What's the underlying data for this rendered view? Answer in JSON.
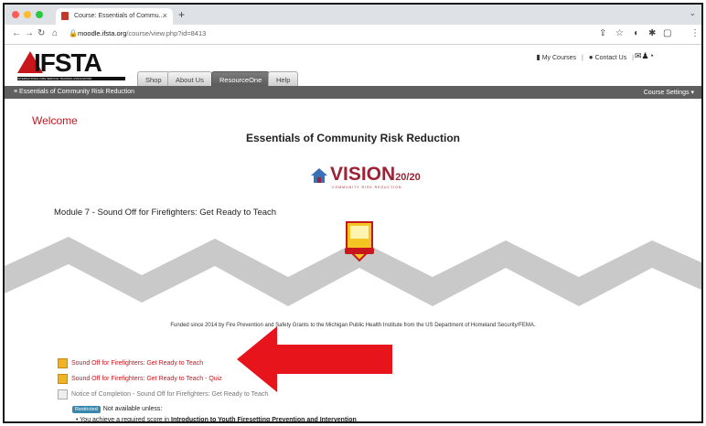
{
  "browser": {
    "tab_title": "Course: Essentials of Commu...",
    "new_tab": "+",
    "url_host": "moodle.ifsta.org",
    "url_path": "/course/view.php?id=8413"
  },
  "site": {
    "logo_text": "IFSTA",
    "logo_tagline": "INTERNATIONAL FIRE SERVICE TRAINING ASSOCIATION",
    "nav_tabs": [
      {
        "label": "Shop"
      },
      {
        "label": "About Us"
      },
      {
        "label": "ResourceOne"
      },
      {
        "label": "Help"
      }
    ],
    "my_courses": "My Courses",
    "contact_us": "Contact Us",
    "separator": "|",
    "breadcrumb": "Essentials of Community Risk Reduction",
    "course_settings": "Course Settings ▾"
  },
  "content": {
    "welcome": "Welcome",
    "course_title": "Essentials of Community Risk Reduction",
    "vision_text": "VISION",
    "vision_sub": "20/20",
    "vision_tag": "COMMUNITY RISK REDUCTION",
    "module_title": "Module 7 - Sound Off for Firefighters: Get Ready to Teach",
    "funded": "Funded since 2014 by Fire Prevention and Safety Grants to the Michigan Public Health Institute from the US Department of Homeland Security/FEMA.",
    "activities": [
      {
        "label": "Sound Off for Firefighters: Get Ready to Teach"
      },
      {
        "label": "Sound Off for Firefighters: Get Ready to Teach - Quiz"
      },
      {
        "label": "Notice of Completion - Sound Off for Firefighters: Get Ready to Teach"
      }
    ],
    "restricted_pill": "Restricted",
    "restricted_text": "Not available unless:",
    "requirement_prefix": "• You achieve a required score in ",
    "requirement_course": "Introduction to Youth Firesetting Prevention and Intervention"
  },
  "colors": {
    "brand_red": "#c8161d",
    "arrow_red": "#e8141b",
    "nav_dark": "#5f5f5f"
  }
}
